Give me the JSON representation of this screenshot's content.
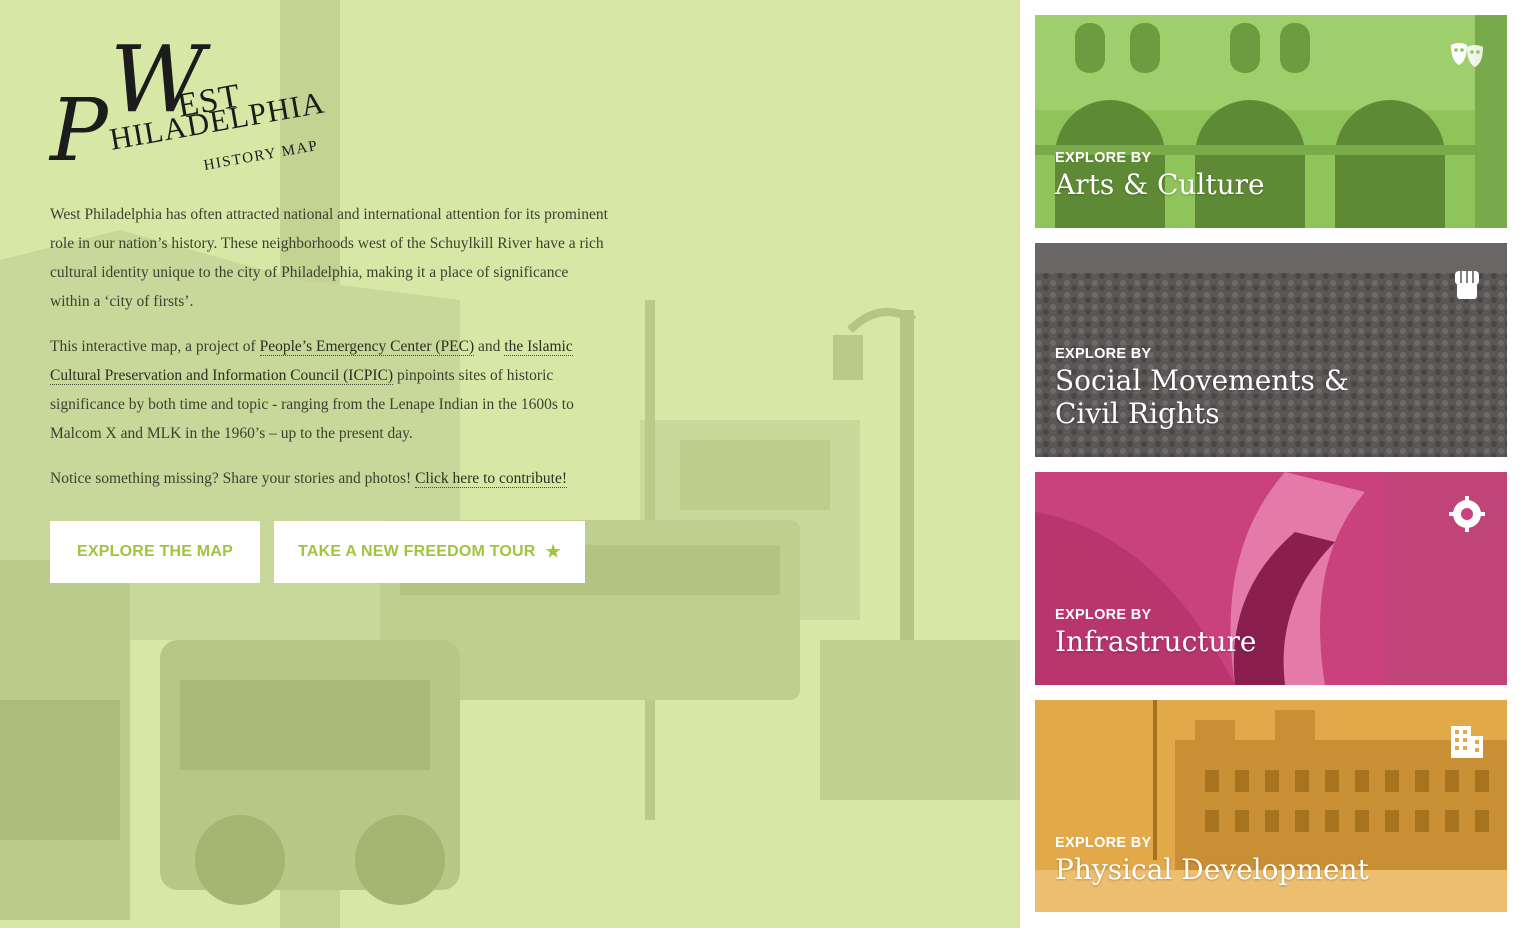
{
  "logo": {
    "initial_w": "W",
    "rest_est": "EST",
    "initial_p": "P",
    "rest_hil": "HILADELPHIA",
    "subtitle": "HISTORY MAP"
  },
  "intro": {
    "para1": "West Philadelphia has often attracted national and international attention for its prominent role in our nation’s history. These neighborhoods west of the Schuylkill River have a rich cultural identity unique to the city of Philadelphia, making it a place of significance within a ‘city of firsts’.",
    "para2_a": "This interactive map, a project of ",
    "para2_link1": "People’s Emergency Center (PEC)",
    "para2_b": " and ",
    "para2_link2": "the Islamic Cultural Preservation and Information Council (ICPIC)",
    "para2_c": " pinpoints sites of historic significance by both time and topic - ranging from the Lenape Indian in the 1600s to Malcom X and MLK in the 1960’s – up to the present day.",
    "para3_a": "Notice something missing? Share your stories and photos! ",
    "para3_link": "Click here to contribute!"
  },
  "buttons": {
    "explore_map": "EXPLORE THE MAP",
    "freedom_tour": "TAKE A NEW FREEDOM TOUR",
    "freedom_tour_icon": "★"
  },
  "cards": [
    {
      "eyebrow": "EXPLORE BY",
      "title": "Arts & Culture",
      "icon": "theater-masks-icon",
      "color": "#8fc45a"
    },
    {
      "eyebrow": "EXPLORE BY",
      "title": "Social Movements & Civil Rights",
      "title_line1": "Social Movements &",
      "title_line2": "Civil Rights",
      "icon": "raised-fist-icon",
      "color": "#5b5757"
    },
    {
      "eyebrow": "EXPLORE BY",
      "title": "Infrastructure",
      "icon": "gear-wrench-icon",
      "color": "#c9417d"
    },
    {
      "eyebrow": "EXPLORE BY",
      "title": "Physical Development",
      "icon": "buildings-icon",
      "color": "#e1a94a"
    }
  ],
  "colors": {
    "hero_bg": "#d7e8a6",
    "button_text": "#9fc43f"
  }
}
